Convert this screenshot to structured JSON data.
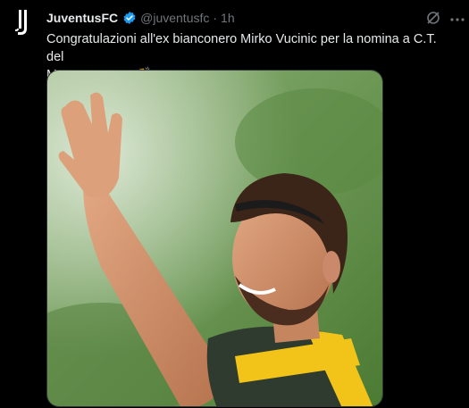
{
  "tweet": {
    "display_name": "JuventusFC",
    "handle": "@juventusfc",
    "separator": "·",
    "time": "1h",
    "text_line1": "Congratulazioni all'ex bianconero Mirko Vucinic per la nomina a C.T. del",
    "text_line2": "Montenegro!",
    "icons": {
      "avatar": "juventus-logo-icon",
      "verified": "verified-badge-icon",
      "grok": "grok-icon",
      "more": "more-options-icon",
      "flag": "montenegro-flag-emoji",
      "clap": "clapping-hands-emoji"
    },
    "media": {
      "kind": "photo",
      "subject": "player-waving"
    }
  },
  "colors": {
    "background": "#000000",
    "text": "#e7e9ea",
    "secondary_text": "#71767b",
    "verified_blue": "#1d9bf0",
    "border": "#2f3336",
    "jersey_yellow": "#f2c41a"
  }
}
